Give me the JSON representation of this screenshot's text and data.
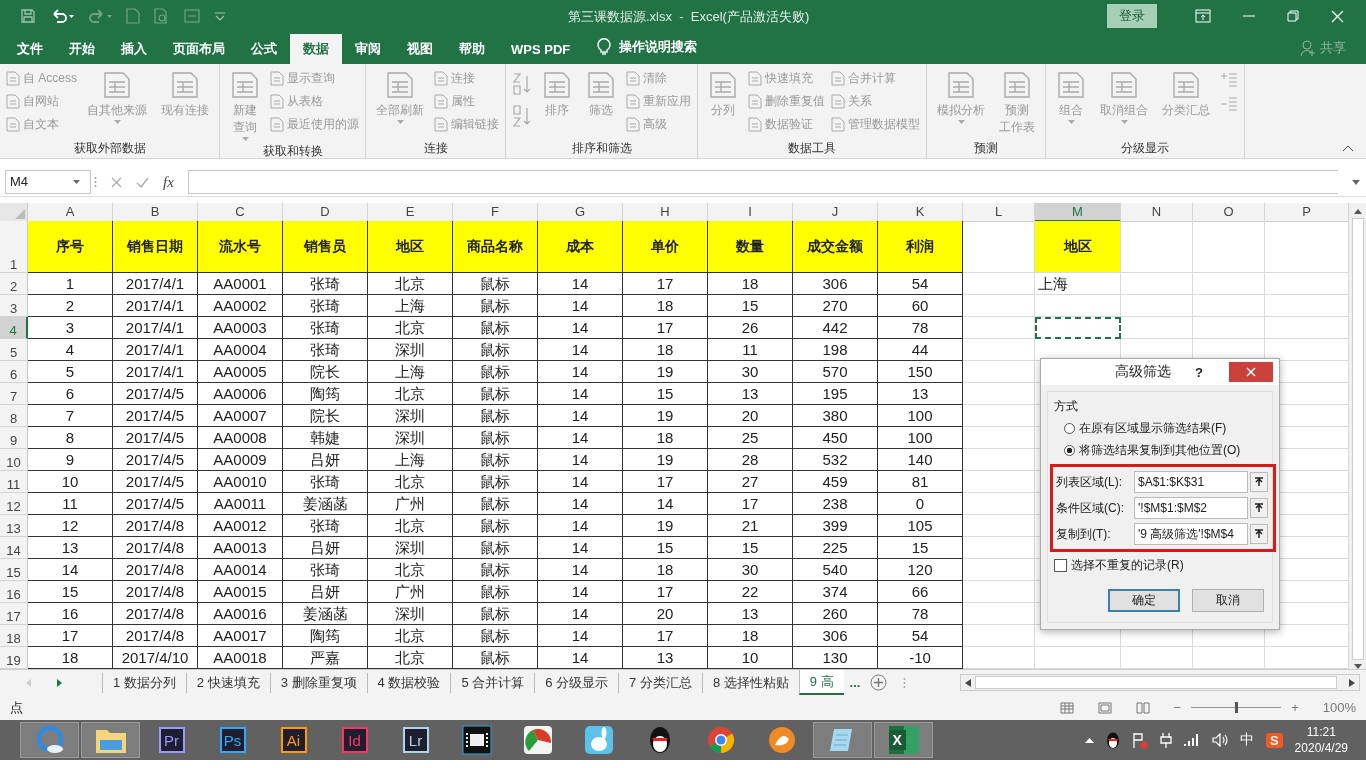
{
  "title_bar": {
    "document_title": "第三课数据源.xlsx  -  Excel(产品激活失败)",
    "sign_in": "登录"
  },
  "ribbon_tabs": [
    {
      "label": "文件",
      "selected": false
    },
    {
      "label": "开始",
      "selected": false
    },
    {
      "label": "插入",
      "selected": false
    },
    {
      "label": "页面布局",
      "selected": false
    },
    {
      "label": "公式",
      "selected": false
    },
    {
      "label": "数据",
      "selected": true
    },
    {
      "label": "审阅",
      "selected": false
    },
    {
      "label": "视图",
      "selected": false
    },
    {
      "label": "帮助",
      "selected": false
    },
    {
      "label": "WPS PDF",
      "selected": false
    }
  ],
  "tell_me": "操作说明搜索",
  "share": "共享",
  "ribbon_groups": [
    {
      "label": "获取外部数据",
      "columns": [
        {
          "kind": "stack",
          "items": [
            "自 Access",
            "自网站",
            "自文本"
          ]
        },
        {
          "kind": "large",
          "label": "自其他来源",
          "dropdown": true
        },
        {
          "kind": "large",
          "label": "现有连接",
          "dropdown": false
        }
      ]
    },
    {
      "label": "获取和转换",
      "columns": [
        {
          "kind": "large",
          "lines": [
            "新建",
            "查询"
          ],
          "dropdown": true
        },
        {
          "kind": "stack",
          "items": [
            "显示查询",
            "从表格",
            "最近使用的源"
          ]
        }
      ]
    },
    {
      "label": "连接",
      "columns": [
        {
          "kind": "large",
          "label": "全部刷新",
          "dropdown": true
        },
        {
          "kind": "stack",
          "items": [
            "连接",
            "属性",
            "编辑链接"
          ]
        }
      ]
    },
    {
      "label": "排序和筛选",
      "columns": [
        {
          "kind": "sort_icons"
        },
        {
          "kind": "large",
          "label": "排序",
          "dropdown": false
        },
        {
          "kind": "large",
          "label": "筛选",
          "dropdown": false
        },
        {
          "kind": "stack",
          "items": [
            "清除",
            "重新应用",
            "高级"
          ]
        }
      ]
    },
    {
      "label": "数据工具",
      "columns": [
        {
          "kind": "large",
          "label": "分列",
          "dropdown": false
        },
        {
          "kind": "stack",
          "items": [
            "快速填充",
            "删除重复值",
            "数据验证"
          ]
        },
        {
          "kind": "stack",
          "items": [
            "合并计算",
            "关系",
            "管理数据模型"
          ]
        }
      ]
    },
    {
      "label": "预测",
      "columns": [
        {
          "kind": "large",
          "label": "模拟分析",
          "dropdown": true
        },
        {
          "kind": "large",
          "lines": [
            "预测",
            "工作表"
          ],
          "dropdown": false
        }
      ]
    },
    {
      "label": "分级显示",
      "columns": [
        {
          "kind": "large",
          "label": "组合",
          "dropdown": true
        },
        {
          "kind": "large",
          "label": "取消组合",
          "dropdown": true
        },
        {
          "kind": "large",
          "label": "分类汇总",
          "dropdown": false
        },
        {
          "kind": "icon_stack"
        }
      ]
    }
  ],
  "formula_bar": {
    "name_box": "M4",
    "function_label": "fx"
  },
  "sheet": {
    "columns": [
      {
        "letter": "A",
        "selected": false
      },
      {
        "letter": "B",
        "selected": false
      },
      {
        "letter": "C",
        "selected": false
      },
      {
        "letter": "D",
        "selected": false
      },
      {
        "letter": "E",
        "selected": false
      },
      {
        "letter": "F",
        "selected": false
      },
      {
        "letter": "G",
        "selected": false
      },
      {
        "letter": "H",
        "selected": false
      },
      {
        "letter": "I",
        "selected": false
      },
      {
        "letter": "J",
        "selected": false
      },
      {
        "letter": "K",
        "selected": false
      },
      {
        "letter": "L",
        "selected": false
      },
      {
        "letter": "M",
        "selected": true
      },
      {
        "letter": "N",
        "selected": false
      },
      {
        "letter": "O",
        "selected": false
      },
      {
        "letter": "P",
        "selected": false
      }
    ],
    "rows": [
      {
        "number": "1",
        "kind": "header",
        "selected": false,
        "cells": [
          "序号",
          "销售日期",
          "流水号",
          "销售员",
          "地区",
          "商品名称",
          "成本",
          "单价",
          "数量",
          "成交金额",
          "利润"
        ],
        "m_cell": "地区"
      },
      {
        "number": "2",
        "kind": "data",
        "selected": false,
        "cells": [
          "1",
          "2017/4/1",
          "AA0001",
          "张琦",
          "北京",
          "鼠标",
          "14",
          "17",
          "18",
          "306",
          "54"
        ],
        "m_cell": "上海"
      },
      {
        "number": "3",
        "kind": "data",
        "selected": false,
        "cells": [
          "2",
          "2017/4/1",
          "AA0002",
          "张琦",
          "上海",
          "鼠标",
          "14",
          "18",
          "15",
          "270",
          "60"
        ]
      },
      {
        "number": "4",
        "kind": "data",
        "selected": true,
        "cells": [
          "3",
          "2017/4/1",
          "AA0003",
          "张琦",
          "北京",
          "鼠标",
          "14",
          "17",
          "26",
          "442",
          "78"
        ]
      },
      {
        "number": "5",
        "kind": "data",
        "selected": false,
        "cells": [
          "4",
          "2017/4/1",
          "AA0004",
          "张琦",
          "深圳",
          "鼠标",
          "14",
          "18",
          "11",
          "198",
          "44"
        ]
      },
      {
        "number": "6",
        "kind": "data",
        "selected": false,
        "cells": [
          "5",
          "2017/4/1",
          "AA0005",
          "院长",
          "上海",
          "鼠标",
          "14",
          "19",
          "30",
          "570",
          "150"
        ]
      },
      {
        "number": "7",
        "kind": "data",
        "selected": false,
        "cells": [
          "6",
          "2017/4/5",
          "AA0006",
          "陶筠",
          "北京",
          "鼠标",
          "14",
          "15",
          "13",
          "195",
          "13"
        ]
      },
      {
        "number": "8",
        "kind": "data",
        "selected": false,
        "cells": [
          "7",
          "2017/4/5",
          "AA0007",
          "院长",
          "深圳",
          "鼠标",
          "14",
          "19",
          "20",
          "380",
          "100"
        ]
      },
      {
        "number": "9",
        "kind": "data",
        "selected": false,
        "cells": [
          "8",
          "2017/4/5",
          "AA0008",
          "韩婕",
          "深圳",
          "鼠标",
          "14",
          "18",
          "25",
          "450",
          "100"
        ]
      },
      {
        "number": "10",
        "kind": "data",
        "selected": false,
        "cells": [
          "9",
          "2017/4/5",
          "AA0009",
          "吕妍",
          "上海",
          "鼠标",
          "14",
          "19",
          "28",
          "532",
          "140"
        ]
      },
      {
        "number": "11",
        "kind": "data",
        "selected": false,
        "cells": [
          "10",
          "2017/4/5",
          "AA0010",
          "张琦",
          "北京",
          "鼠标",
          "14",
          "17",
          "27",
          "459",
          "81"
        ]
      },
      {
        "number": "12",
        "kind": "data",
        "selected": false,
        "cells": [
          "11",
          "2017/4/5",
          "AA0011",
          "姜涵菡",
          "广州",
          "鼠标",
          "14",
          "14",
          "17",
          "238",
          "0"
        ]
      },
      {
        "number": "13",
        "kind": "data",
        "selected": false,
        "cells": [
          "12",
          "2017/4/8",
          "AA0012",
          "张琦",
          "北京",
          "鼠标",
          "14",
          "19",
          "21",
          "399",
          "105"
        ]
      },
      {
        "number": "14",
        "kind": "data",
        "selected": false,
        "cells": [
          "13",
          "2017/4/8",
          "AA0013",
          "吕妍",
          "深圳",
          "鼠标",
          "14",
          "15",
          "15",
          "225",
          "15"
        ]
      },
      {
        "number": "15",
        "kind": "data",
        "selected": false,
        "cells": [
          "14",
          "2017/4/8",
          "AA0014",
          "张琦",
          "北京",
          "鼠标",
          "14",
          "18",
          "30",
          "540",
          "120"
        ]
      },
      {
        "number": "16",
        "kind": "data",
        "selected": false,
        "cells": [
          "15",
          "2017/4/8",
          "AA0015",
          "吕妍",
          "广州",
          "鼠标",
          "14",
          "17",
          "22",
          "374",
          "66"
        ]
      },
      {
        "number": "17",
        "kind": "data",
        "selected": false,
        "cells": [
          "16",
          "2017/4/8",
          "AA0016",
          "姜涵菡",
          "深圳",
          "鼠标",
          "14",
          "20",
          "13",
          "260",
          "78"
        ]
      },
      {
        "number": "18",
        "kind": "data",
        "selected": false,
        "cells": [
          "17",
          "2017/4/8",
          "AA0017",
          "陶筠",
          "北京",
          "鼠标",
          "14",
          "17",
          "18",
          "306",
          "54"
        ]
      },
      {
        "number": "19",
        "kind": "data",
        "selected": false,
        "cells": [
          "18",
          "2017/4/10",
          "AA0018",
          "严嘉",
          "北京",
          "鼠标",
          "14",
          "13",
          "10",
          "130",
          "-10"
        ]
      }
    ]
  },
  "dialog": {
    "title": "高级筛选",
    "help": "?",
    "section": "方式",
    "annotation_frame": true,
    "options": [
      {
        "label": "在原有区域显示筛选结果(F)",
        "selected": false
      },
      {
        "label": "将筛选结果复制到其他位置(O)",
        "selected": true
      }
    ],
    "fields": [
      {
        "label": "列表区域(L):",
        "value": "$A$1:$K$31"
      },
      {
        "label": "条件区域(C):",
        "value": "'!$M$1:$M$2"
      },
      {
        "label": "复制到(T):",
        "value": "'9 高级筛选'!$M$4"
      }
    ],
    "unique_checkbox": {
      "label": "选择不重复的记录(R)",
      "checked": false
    },
    "buttons": [
      {
        "label": "确定",
        "kind": "default"
      },
      {
        "label": "取消",
        "kind": "normal"
      }
    ]
  },
  "sheet_tabs": [
    {
      "label": "1 数据分列",
      "selected": false
    },
    {
      "label": "2 快速填充",
      "selected": false
    },
    {
      "label": "3 删除重复项",
      "selected": false
    },
    {
      "label": "4 数据校验",
      "selected": false
    },
    {
      "label": "5 合并计算",
      "selected": false
    },
    {
      "label": "6 分级显示",
      "selected": false
    },
    {
      "label": "7 分类汇总",
      "selected": false
    },
    {
      "label": "8 选择性粘贴",
      "selected": false
    },
    {
      "label": "9 高",
      "selected": true
    }
  ],
  "more_tabs": "...",
  "status_bar": {
    "mode": "点",
    "zoom_minus": "−",
    "zoom_plus": "+",
    "zoom_slider": {
      "level": 0.5
    },
    "zoom_percent": "100%"
  },
  "taskbar": {
    "apps": [
      {
        "kind": "browser",
        "open": true
      },
      {
        "kind": "folder",
        "open": true
      },
      {
        "kind": "badge",
        "label": "Pr",
        "color": "#9999ff",
        "open": false
      },
      {
        "kind": "badge",
        "label": "Ps",
        "color": "#31a8ff",
        "open": false
      },
      {
        "kind": "badge",
        "label": "Ai",
        "color": "#ff9a00",
        "open": false
      },
      {
        "kind": "badge",
        "label": "Id",
        "color": "#ff3366",
        "open": false
      },
      {
        "kind": "badge",
        "label": "Lr",
        "color": "#add5ec",
        "open": false
      },
      {
        "kind": "film",
        "open": false
      },
      {
        "kind": "chart",
        "open": false
      },
      {
        "kind": "rabbit",
        "open": false
      },
      {
        "kind": "penguin",
        "open": false
      },
      {
        "kind": "chrome",
        "open": false
      },
      {
        "kind": "cat",
        "open": false
      },
      {
        "kind": "notepad",
        "open": true
      },
      {
        "kind": "excel",
        "label": "X",
        "open": true
      }
    ],
    "ime": "中",
    "ime_logo": "S",
    "time": "11:21",
    "date": "2020/4/29"
  }
}
